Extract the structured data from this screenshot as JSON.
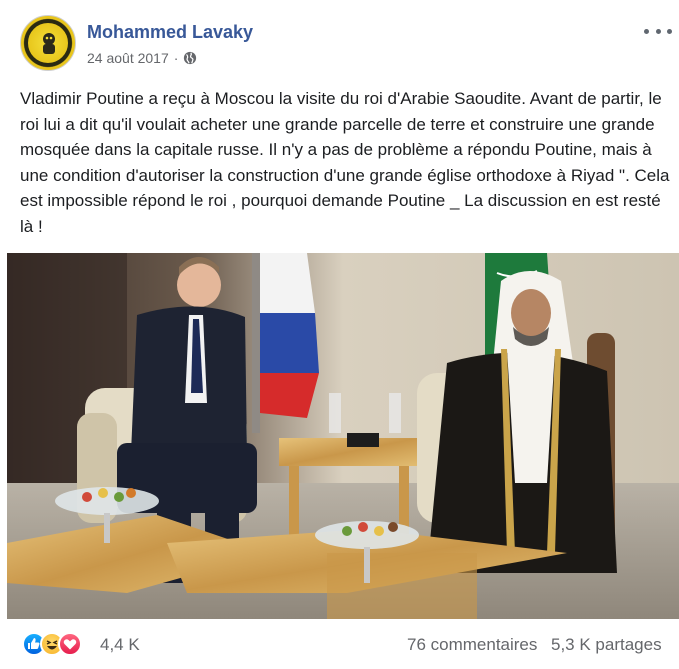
{
  "post": {
    "author": "Mohammed Lavaky",
    "date": "24 août 2017",
    "separator": "·",
    "privacy_icon": "globe-icon",
    "more_icon": "more-options-icon",
    "text": "Vladimir Poutine a reçu à Moscou la visite du roi d'Arabie Saoudite. Avant de partir, le roi lui a dit qu'il voulait acheter une grande parcelle de terre et construire une grande mosquée dans la capitale russe. Il n'y a pas de problème a répondu Poutine, mais à une condition d'autoriser la construction d'une grande église orthodoxe à Riyad \". Cela est impossible répond le roi , pourquoi demande Poutine _ La discussion en est resté là !"
  },
  "reactions": {
    "icons": [
      "like-icon",
      "haha-icon",
      "love-icon"
    ],
    "count": "4,4 K",
    "comments": "76 commentaires",
    "shares": "5,3 K partages"
  },
  "colors": {
    "author_link": "#385898",
    "meta_text": "#65676b",
    "like_blue": "#1877f2",
    "love_red": "#f33e58",
    "haha_yellow": "#f7b125"
  }
}
